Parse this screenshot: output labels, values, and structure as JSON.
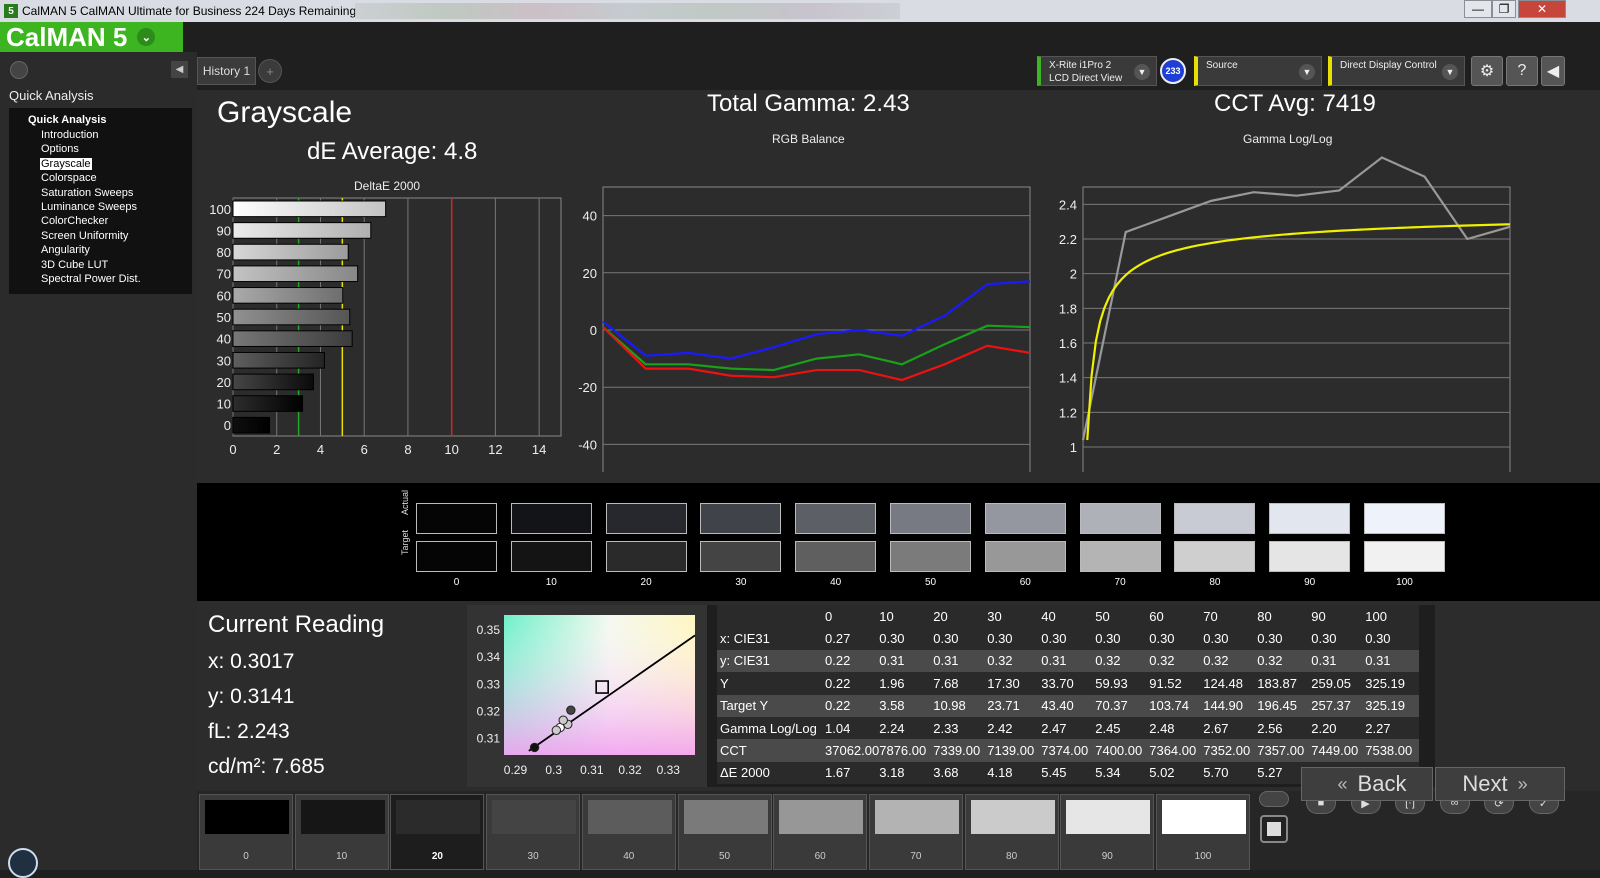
{
  "window": {
    "title": "CalMAN 5 CalMAN Ultimate for Business 224 Days Remaining",
    "icon": "5",
    "buttons": [
      "—",
      "❐",
      "✕"
    ]
  },
  "logo": {
    "text": "CalMAN 5",
    "caret": "⌄"
  },
  "sidebar": {
    "header": "Quick Analysis",
    "root": "Quick Analysis",
    "items": [
      {
        "label": "Introduction"
      },
      {
        "label": "Options"
      },
      {
        "label": "Grayscale",
        "selected": true
      },
      {
        "label": "Colorspace"
      },
      {
        "label": "Saturation Sweeps"
      },
      {
        "label": "Luminance Sweeps"
      },
      {
        "label": "ColorChecker"
      },
      {
        "label": "Screen Uniformity"
      },
      {
        "label": "Angularity"
      },
      {
        "label": "3D Cube LUT"
      },
      {
        "label": "Spectral Power Dist."
      }
    ]
  },
  "tabs": {
    "history": "History 1",
    "add": "+"
  },
  "devices": {
    "meter": {
      "line1": "X-Rite i1Pro 2",
      "line2": "LCD Direct View",
      "accent": "#3cb521"
    },
    "probe_badge": "233",
    "source": {
      "label": "Source",
      "accent": "#e8e000"
    },
    "display": {
      "label": "Direct Display Control",
      "accent": "#e8e000"
    },
    "buttons": [
      "gear-icon",
      "help-icon",
      "collapse-icon"
    ]
  },
  "summary": {
    "title": "Grayscale",
    "de_average": "dE Average: 4.8",
    "total_gamma": "Total Gamma: 2.43",
    "cct_avg": "CCT Avg: 7419"
  },
  "chart_data": [
    {
      "type": "bar",
      "title": "DeltaE 2000",
      "orientation": "horizontal",
      "categories": [
        "100",
        "90",
        "80",
        "70",
        "60",
        "50",
        "40",
        "30",
        "20",
        "10",
        "0"
      ],
      "values": [
        6.98,
        6.3,
        5.27,
        5.7,
        5.02,
        5.34,
        5.45,
        4.18,
        3.68,
        3.18,
        1.67
      ],
      "xlim": [
        0,
        15
      ],
      "xticks": [
        "0",
        "2",
        "4",
        "6",
        "8",
        "10",
        "12",
        "14"
      ],
      "threshold_lines": [
        {
          "value": 3,
          "color": "#22aa22"
        },
        {
          "value": 5,
          "color": "#e8e000"
        },
        {
          "value": 10,
          "color": "#dd2222"
        }
      ]
    },
    {
      "type": "line",
      "title": "RGB Balance",
      "x": [
        0,
        10,
        20,
        30,
        40,
        50,
        60,
        70,
        80,
        90,
        100
      ],
      "xticks": [
        "0",
        "10",
        "20",
        "30",
        "40",
        "50",
        "60",
        "70",
        "80",
        "90",
        "100"
      ],
      "yticks": [
        "40",
        "20",
        "0",
        "-20",
        "-40"
      ],
      "ylim": [
        -50,
        50
      ],
      "series": [
        {
          "color": "#1a1aff",
          "values": [
            3,
            -9,
            -8,
            -10,
            -6,
            -1.5,
            0,
            -2,
            5,
            16,
            17
          ]
        },
        {
          "color": "#1aa11a",
          "values": [
            1,
            -12,
            -12,
            -13.5,
            -14,
            -10,
            -8.5,
            -12,
            -5,
            1.5,
            1
          ]
        },
        {
          "color": "#ee1111",
          "values": [
            1,
            -13.5,
            -13.5,
            -16,
            -16.5,
            -14,
            -14,
            -17.5,
            -12,
            -5.5,
            -8
          ]
        }
      ]
    },
    {
      "type": "line",
      "title": "Gamma Log/Log",
      "x": [
        0,
        10,
        20,
        30,
        40,
        50,
        60,
        70,
        80,
        90,
        100
      ],
      "xticks": [
        "0",
        "10",
        "20",
        "30",
        "40",
        "50",
        "60",
        "70",
        "80",
        "90",
        "100"
      ],
      "yticks": [
        "2.4",
        "2.2",
        "2",
        "1.8",
        "1.6",
        "1.4",
        "1.2",
        "1"
      ],
      "ylim": [
        0.85,
        2.5
      ],
      "series": [
        {
          "color": "#999999",
          "values": [
            1.04,
            2.24,
            2.33,
            2.42,
            2.47,
            2.45,
            2.48,
            2.67,
            2.56,
            2.2,
            2.27
          ]
        },
        {
          "color": "#f0f000",
          "target_gamma": 2.4
        }
      ]
    },
    {
      "type": "scatter",
      "title": "CIE",
      "xticks": [
        "0.29",
        "0.3",
        "0.31",
        "0.32",
        "0.33"
      ],
      "yticks": [
        "0.35",
        "0.34",
        "0.33",
        "0.32",
        "0.31"
      ],
      "xlim": [
        0.287,
        0.337
      ],
      "ylim": [
        0.304,
        0.3555
      ],
      "points": [
        {
          "x": 0.3017,
          "y": 0.3141
        },
        {
          "x": 0.3037,
          "y": 0.3153
        },
        {
          "x": 0.3007,
          "y": 0.3131
        },
        {
          "x": 0.3025,
          "y": 0.3168
        },
        {
          "x": 0.3045,
          "y": 0.3205
        },
        {
          "x": 0.295,
          "y": 0.3068
        }
      ],
      "target": {
        "x": 0.3127,
        "y": 0.329
      }
    }
  ],
  "swatches": {
    "row_labels": [
      "Actual",
      "Target"
    ],
    "levels": [
      "0",
      "10",
      "20",
      "30",
      "40",
      "50",
      "60",
      "70",
      "80",
      "90",
      "100"
    ],
    "actual": [
      "#050506",
      "#131418",
      "#27282d",
      "#41434a",
      "#5c5f66",
      "#777a82",
      "#94979f",
      "#aeb1b8",
      "#c8cbd3",
      "#e1e6ef",
      "#eef3fb"
    ],
    "target": [
      "#050505",
      "#141414",
      "#2a2a2a",
      "#444444",
      "#5f5f5f",
      "#7b7b7b",
      "#989898",
      "#b4b4b4",
      "#cfcfcf",
      "#e5e5e5",
      "#f1f1f1"
    ]
  },
  "current_reading": {
    "title": "Current Reading",
    "x": "x: 0.3017",
    "y": "y: 0.3141",
    "fl": "fL: 2.243",
    "cdm2": "cd/m²: 7.685"
  },
  "table": {
    "headers": [
      "",
      "0",
      "10",
      "20",
      "30",
      "40",
      "50",
      "60",
      "70",
      "80",
      "90",
      "100"
    ],
    "rows": [
      {
        "label": "x: CIE31",
        "values": [
          "0.27",
          "0.30",
          "0.30",
          "0.30",
          "0.30",
          "0.30",
          "0.30",
          "0.30",
          "0.30",
          "0.30",
          "0.30"
        ]
      },
      {
        "label": "y: CIE31",
        "values": [
          "0.22",
          "0.31",
          "0.31",
          "0.32",
          "0.31",
          "0.32",
          "0.32",
          "0.32",
          "0.32",
          "0.31",
          "0.31"
        ]
      },
      {
        "label": "Y",
        "values": [
          "0.22",
          "1.96",
          "7.68",
          "17.30",
          "33.70",
          "59.93",
          "91.52",
          "124.48",
          "183.87",
          "259.05",
          "325.19"
        ]
      },
      {
        "label": "Target Y",
        "values": [
          "0.22",
          "3.58",
          "10.98",
          "23.71",
          "43.40",
          "70.37",
          "103.74",
          "144.90",
          "196.45",
          "257.37",
          "325.19"
        ]
      },
      {
        "label": "Gamma Log/Log",
        "values": [
          "1.04",
          "2.24",
          "2.33",
          "2.42",
          "2.47",
          "2.45",
          "2.48",
          "2.67",
          "2.56",
          "2.20",
          "2.27"
        ]
      },
      {
        "label": "CCT",
        "values": [
          "37062.00",
          "7876.00",
          "7339.00",
          "7139.00",
          "7374.00",
          "7400.00",
          "7364.00",
          "7352.00",
          "7357.00",
          "7449.00",
          "7538.00"
        ]
      },
      {
        "label": "ΔE 2000",
        "values": [
          "1.67",
          "3.18",
          "3.68",
          "4.18",
          "5.45",
          "5.34",
          "5.02",
          "5.70",
          "5.27",
          "6.30",
          "6.98"
        ]
      }
    ]
  },
  "patches": {
    "labels": [
      "0",
      "10",
      "20",
      "30",
      "40",
      "50",
      "60",
      "70",
      "80",
      "90",
      "100"
    ],
    "colors": [
      "#000000",
      "#161616",
      "#2b2b2b",
      "#444444",
      "#5c5c5c",
      "#7a7a7a",
      "#979797",
      "#b3b3b3",
      "#cbcbcb",
      "#e6e6e6",
      "#ffffff"
    ],
    "current_index": 2
  },
  "controls": {
    "icons": [
      "stop-icon",
      "play-icon",
      "measure-icon",
      "loop-icon",
      "refresh-icon",
      "check-icon"
    ],
    "glyphs": [
      "■",
      "▶",
      "[·]",
      "∞",
      "⟳",
      "✓"
    ],
    "back": "Back",
    "next": "Next",
    "back_chev": "«",
    "next_chev": "»"
  }
}
